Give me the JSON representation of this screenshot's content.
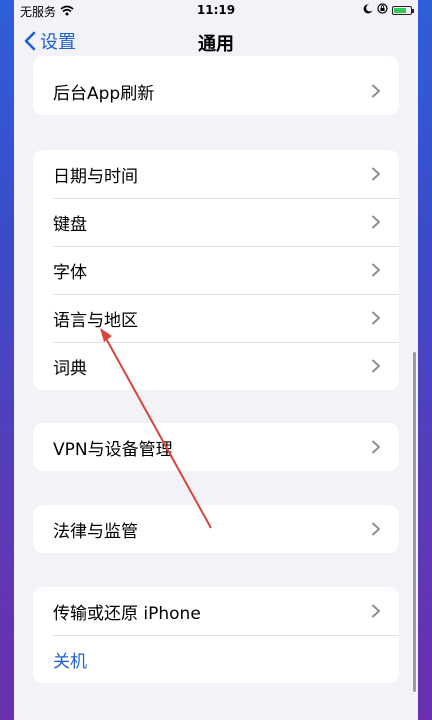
{
  "status_bar": {
    "carrier": "无服务",
    "time": "11:19",
    "icons": [
      "wifi-icon",
      "moon-icon",
      "rotation-lock-icon",
      "battery-charging-icon"
    ]
  },
  "nav": {
    "back_label": "设置",
    "title": "通用"
  },
  "groups": [
    {
      "items": [
        {
          "label": "后台App刷新"
        }
      ]
    },
    {
      "items": [
        {
          "label": "日期与时间"
        },
        {
          "label": "键盘"
        },
        {
          "label": "字体"
        },
        {
          "label": "语言与地区"
        },
        {
          "label": "词典"
        }
      ]
    },
    {
      "items": [
        {
          "label": "VPN与设备管理"
        }
      ]
    },
    {
      "items": [
        {
          "label": "法律与监管"
        }
      ]
    },
    {
      "items": [
        {
          "label": "传输或还原 iPhone"
        },
        {
          "label": "关机"
        }
      ]
    }
  ],
  "colors": {
    "accent": "#1e5fd1",
    "annotation_arrow": "#d9433c",
    "background": "#f2f2f7"
  }
}
